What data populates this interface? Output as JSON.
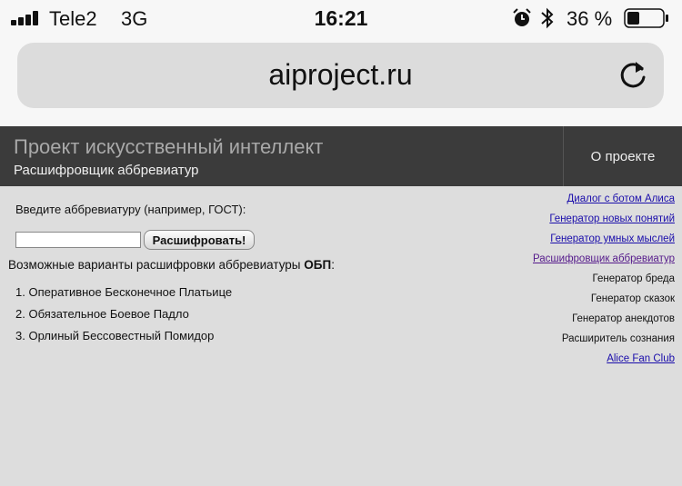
{
  "status_bar": {
    "carrier": "Tele2",
    "network": "3G",
    "time": "16:21",
    "battery_percent": "36 %",
    "battery_level": 0.36,
    "icons": [
      "signal-icon",
      "alarm-icon",
      "bluetooth-icon",
      "battery-icon"
    ]
  },
  "browser": {
    "url": "aiproject.ru",
    "reload_icon": "reload-icon"
  },
  "header": {
    "title": "Проект искусственный интеллект",
    "subtitle": "Расшифровщик аббревиатур",
    "about_link": "О проекте"
  },
  "main": {
    "prompt": "Введите аббревиатуру (например, ГОСТ):",
    "input": {
      "value": "",
      "placeholder": ""
    },
    "decode_button": "Расшифровать!",
    "results_heading_prefix": "Возможные варианты расшифровки аббревиатуры ",
    "abbreviation": "ОБП",
    "results_heading_suffix": ":",
    "results": [
      "1. Оперативное Бесконечное Платьице",
      "2. Обязательное Боевое Падло",
      "3. Орлиный Бессовестный Помидор"
    ]
  },
  "sidebar": {
    "items": [
      {
        "label": "Диалог с ботом Алиса",
        "link": true
      },
      {
        "label": "Генератор новых понятий",
        "link": true
      },
      {
        "label": "Генератор умных мыслей",
        "link": true
      },
      {
        "label": "Расшифровщик аббревиатур",
        "link": true
      },
      {
        "label": "Генератор бреда",
        "link": false
      },
      {
        "label": "Генератор сказок",
        "link": false
      },
      {
        "label": "Генератор анекдотов",
        "link": false
      },
      {
        "label": "Расширитель сознания",
        "link": false
      },
      {
        "label": "Alice Fan Club",
        "link": true
      }
    ]
  },
  "colors": {
    "header_bg": "#3b3b3b",
    "content_bg": "#dddddd",
    "link": "#1a0dab",
    "visited_link": "#551a8b"
  }
}
